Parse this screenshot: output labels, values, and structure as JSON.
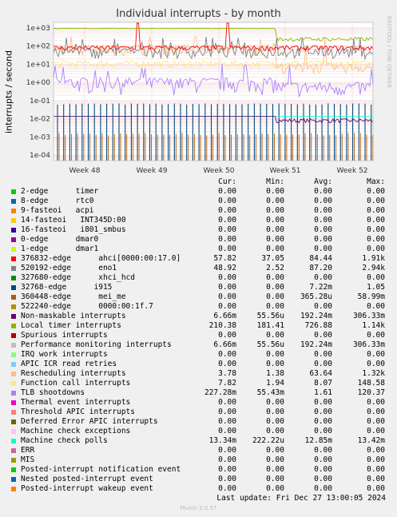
{
  "chart_data": {
    "type": "line",
    "title": "Individual interrupts - by month",
    "ylabel": "interrupts / second",
    "yscale": "log",
    "ylim": [
      5e-05,
      2000
    ],
    "yticks": [
      "1e+03",
      "1e+02",
      "1e+01",
      "1e+00",
      "1e-01",
      "1e-02",
      "1e-03",
      "1e-04"
    ],
    "xticks": [
      "Week 48",
      "Week 49",
      "Week 50",
      "Week 51",
      "Week 52"
    ],
    "grid": true,
    "legend_headers": [
      "Cur:",
      "Min:",
      "Avg:",
      "Max:"
    ],
    "series": [
      {
        "name": "2-edge      timer",
        "color": "#00cc00",
        "cur": "0.00",
        "min": "0.00",
        "avg": "0.00",
        "max": "0.00"
      },
      {
        "name": "8-edge      rtc0",
        "color": "#0066b3",
        "cur": "0.00",
        "min": "0.00",
        "avg": "0.00",
        "max": "0.00"
      },
      {
        "name": "9-fasteoi   acpi",
        "color": "#ff8000",
        "cur": "0.00",
        "min": "0.00",
        "avg": "0.00",
        "max": "0.00"
      },
      {
        "name": "14-fasteoi   INT345D:00",
        "color": "#ffcc00",
        "cur": "0.00",
        "min": "0.00",
        "avg": "0.00",
        "max": "0.00"
      },
      {
        "name": "16-fasteoi   i801_smbus",
        "color": "#330099",
        "cur": "0.00",
        "min": "0.00",
        "avg": "0.00",
        "max": "0.00"
      },
      {
        "name": "0-edge      dmar0",
        "color": "#990099",
        "cur": "0.00",
        "min": "0.00",
        "avg": "0.00",
        "max": "0.00"
      },
      {
        "name": "1-edge      dmar1",
        "color": "#ccff00",
        "cur": "0.00",
        "min": "0.00",
        "avg": "0.00",
        "max": "0.00"
      },
      {
        "name": "376832-edge      ahci[0000:00:17.0]",
        "color": "#ff0000",
        "cur": "57.82",
        "min": "37.05",
        "avg": "84.44",
        "max": "1.91k"
      },
      {
        "name": "520192-edge      eno1",
        "color": "#808080",
        "cur": "48.92",
        "min": "2.52",
        "avg": "87.20",
        "max": "2.94k"
      },
      {
        "name": "327680-edge      xhci_hcd",
        "color": "#008f00",
        "cur": "0.00",
        "min": "0.00",
        "avg": "0.00",
        "max": "0.00"
      },
      {
        "name": "32768-edge      i915",
        "color": "#00487d",
        "cur": "0.00",
        "min": "0.00",
        "avg": "7.22m",
        "max": "1.05"
      },
      {
        "name": "360448-edge      mei_me",
        "color": "#b35a00",
        "cur": "0.00",
        "min": "0.00",
        "avg": "365.28u",
        "max": "58.99m"
      },
      {
        "name": "522240-edge      0000:00:1f.7",
        "color": "#b38f00",
        "cur": "0.00",
        "min": "0.00",
        "avg": "0.00",
        "max": "0.00"
      },
      {
        "name": "Non-maskable interrupts",
        "color": "#6b006b",
        "cur": "6.66m",
        "min": "55.56u",
        "avg": "192.24m",
        "max": "306.33m"
      },
      {
        "name": "Local timer interrupts",
        "color": "#8fb300",
        "cur": "210.38",
        "min": "181.41",
        "avg": "726.88",
        "max": "1.14k"
      },
      {
        "name": "Spurious interrupts",
        "color": "#b30000",
        "cur": "0.00",
        "min": "0.00",
        "avg": "0.00",
        "max": "0.00"
      },
      {
        "name": "Performance monitoring interrupts",
        "color": "#bebebe",
        "cur": "6.66m",
        "min": "55.56u",
        "avg": "192.24m",
        "max": "306.33m"
      },
      {
        "name": "IRQ work interrupts",
        "color": "#80ff80",
        "cur": "0.00",
        "min": "0.00",
        "avg": "0.00",
        "max": "0.00"
      },
      {
        "name": "APIC ICR read retries",
        "color": "#80c9ff",
        "cur": "0.00",
        "min": "0.00",
        "avg": "0.00",
        "max": "0.00"
      },
      {
        "name": "Rescheduling interrupts",
        "color": "#ffc080",
        "cur": "3.78",
        "min": "1.38",
        "avg": "63.64",
        "max": "1.32k"
      },
      {
        "name": "Function call interrupts",
        "color": "#ffe680",
        "cur": "7.82",
        "min": "1.94",
        "avg": "8.07",
        "max": "148.58"
      },
      {
        "name": "TLB shootdowns",
        "color": "#aa80ff",
        "cur": "227.28m",
        "min": "55.43m",
        "avg": "1.61",
        "max": "120.37"
      },
      {
        "name": "Thermal event interrupts",
        "color": "#ee00cc",
        "cur": "0.00",
        "min": "0.00",
        "avg": "0.00",
        "max": "0.00"
      },
      {
        "name": "Threshold APIC interrupts",
        "color": "#ff8080",
        "cur": "0.00",
        "min": "0.00",
        "avg": "0.00",
        "max": "0.00"
      },
      {
        "name": "Deferred Error APIC interrupts",
        "color": "#666600",
        "cur": "0.00",
        "min": "0.00",
        "avg": "0.00",
        "max": "0.00"
      },
      {
        "name": "Machine check exceptions",
        "color": "#ffbfff",
        "cur": "0.00",
        "min": "0.00",
        "avg": "0.00",
        "max": "0.00"
      },
      {
        "name": "Machine check polls",
        "color": "#00ffcc",
        "cur": "13.34m",
        "min": "222.22u",
        "avg": "12.85m",
        "max": "13.42m"
      },
      {
        "name": "ERR",
        "color": "#cc6699",
        "cur": "0.00",
        "min": "0.00",
        "avg": "0.00",
        "max": "0.00"
      },
      {
        "name": "MIS",
        "color": "#999900",
        "cur": "0.00",
        "min": "0.00",
        "avg": "0.00",
        "max": "0.00"
      },
      {
        "name": "Posted-interrupt notification event",
        "color": "#00cc00",
        "cur": "0.00",
        "min": "0.00",
        "avg": "0.00",
        "max": "0.00"
      },
      {
        "name": "Nested posted-interrupt event",
        "color": "#0066b3",
        "cur": "0.00",
        "min": "0.00",
        "avg": "0.00",
        "max": "0.00"
      },
      {
        "name": "Posted-interrupt wakeup event",
        "color": "#ff8000",
        "cur": "0.00",
        "min": "0.00",
        "avg": "0.00",
        "max": "0.00"
      }
    ]
  },
  "side_text": "RRDTOOL / TOBI OETIKER",
  "last_update": "Last update: Fri Dec 27 13:00:05 2024",
  "footer": "Munin 2.0.57"
}
